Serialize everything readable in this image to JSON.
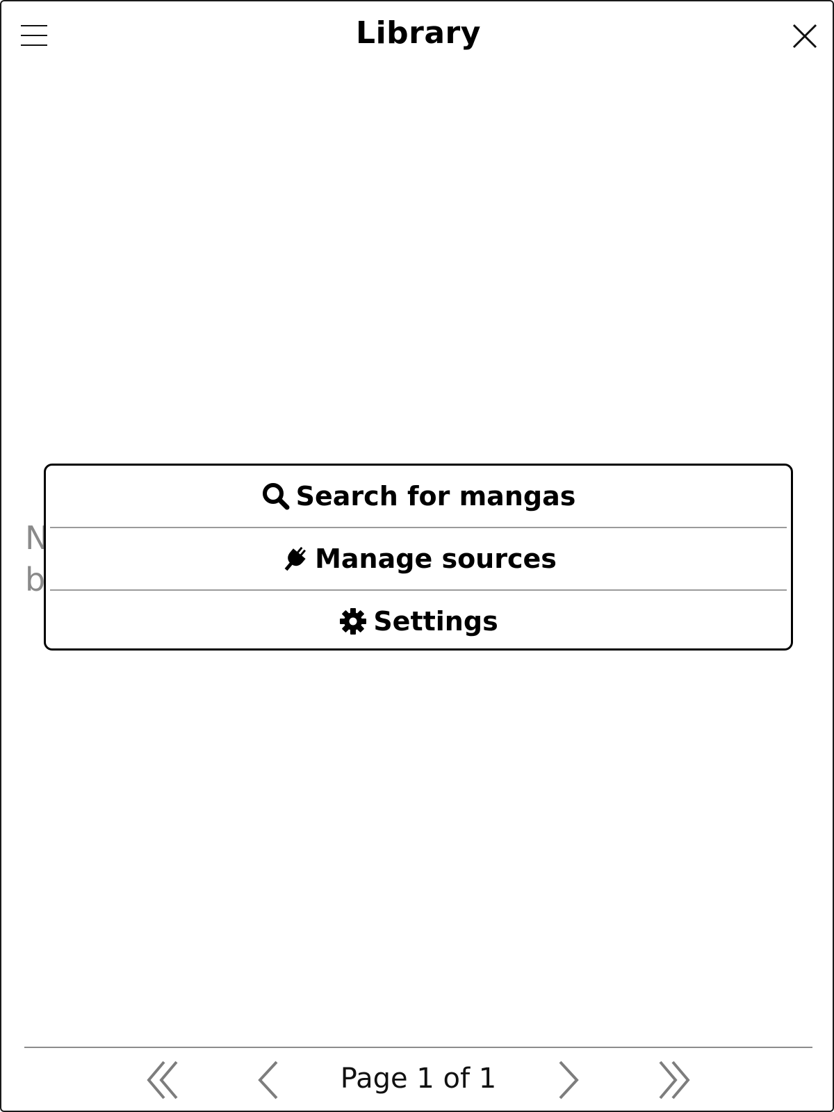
{
  "header": {
    "title": "Library",
    "menu_icon": "hamburger-icon",
    "close_icon": "close-icon"
  },
  "main": {
    "empty_message_visible_fragment": "N\nb"
  },
  "popup": {
    "items": [
      {
        "label": "Search for mangas",
        "icon": "search-icon"
      },
      {
        "label": "Manage sources",
        "icon": "plug-icon"
      },
      {
        "label": "Settings",
        "icon": "gear-icon"
      }
    ]
  },
  "footer": {
    "page_label": "Page 1 of 1",
    "icons": [
      "first-page-icon",
      "previous-page-icon",
      "next-page-icon",
      "last-page-icon"
    ],
    "nav_color": "#7d7d7d"
  }
}
